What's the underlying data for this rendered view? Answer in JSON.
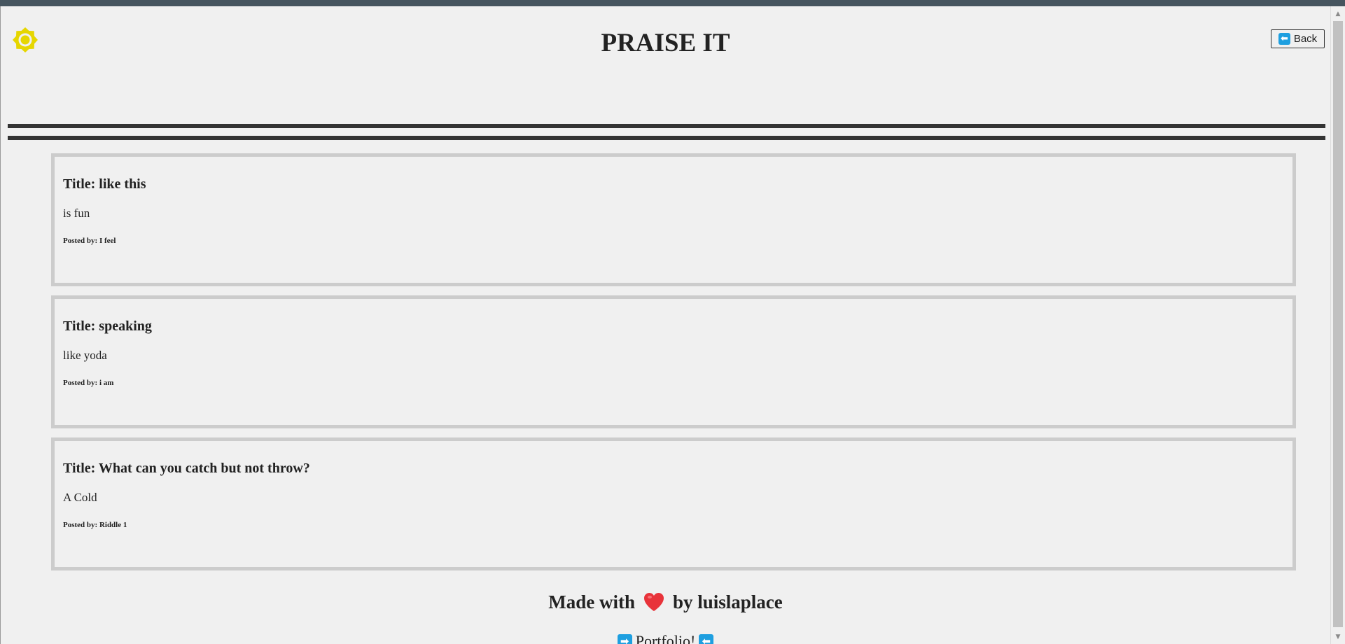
{
  "header": {
    "title": "PRAISE IT",
    "back_label": "Back",
    "theme_icon": "sun-icon",
    "theme_color": "#e6d600"
  },
  "posts": [
    {
      "title": "Title: like this",
      "body": "is fun",
      "author": "Posted by: I feel"
    },
    {
      "title": "Title: speaking",
      "body": "like yoda",
      "author": "Posted by: i am"
    },
    {
      "title": "Title: What can you catch but not throw?",
      "body": "A Cold",
      "author": "Posted by: Riddle 1"
    }
  ],
  "footer": {
    "made_with_prefix": "Made with",
    "made_with_suffix": "by luislaplace",
    "heart_icon": "heart-icon",
    "heart_color": "#e8333a",
    "portfolio_label": "Portfolio!"
  },
  "colors": {
    "background": "#f0f0f0",
    "topbar": "#46555f",
    "divider": "#333333",
    "card_border": "#cccccc",
    "emoji_arrow": "#1e9fe0"
  }
}
